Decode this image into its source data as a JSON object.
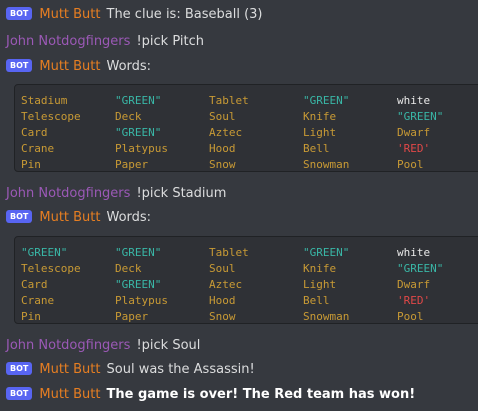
{
  "colors": {
    "background": "#36393f",
    "codeblock_bg": "#2f3136",
    "bot_badge": "#5865f2",
    "bot_author": "#e67e22",
    "user_author": "#9b59b6",
    "word_default": "#c89a35",
    "word_green": "#39b6a6",
    "word_red": "#e04848",
    "word_white": "#e8e8e8"
  },
  "badge_label": "BOT",
  "bot_name": "Mutt Butt",
  "user_name": "John Notdogfingers",
  "messages": {
    "m1": "The clue is: Baseball (3)",
    "m2": "!pick Pitch",
    "m3": "Words:",
    "m4": "!pick Stadium",
    "m5": "Words:",
    "m6": "!pick Soul",
    "m7": "Soul was the Assassin!",
    "m8": "The game is over! The Red team has won!"
  },
  "board1": [
    [
      {
        "text": "Stadium",
        "color": "default"
      },
      {
        "text": "\"GREEN\"",
        "color": "green"
      },
      {
        "text": "Tablet",
        "color": "default"
      },
      {
        "text": "\"GREEN\"",
        "color": "green"
      },
      {
        "text": "white",
        "color": "white"
      }
    ],
    [
      {
        "text": "Telescope",
        "color": "default"
      },
      {
        "text": "Deck",
        "color": "default"
      },
      {
        "text": "Soul",
        "color": "default"
      },
      {
        "text": "Knife",
        "color": "default"
      },
      {
        "text": "\"GREEN\"",
        "color": "green"
      }
    ],
    [
      {
        "text": "Card",
        "color": "default"
      },
      {
        "text": "\"GREEN\"",
        "color": "green"
      },
      {
        "text": "Aztec",
        "color": "default"
      },
      {
        "text": "Light",
        "color": "default"
      },
      {
        "text": "Dwarf",
        "color": "default"
      }
    ],
    [
      {
        "text": "Crane",
        "color": "default"
      },
      {
        "text": "Platypus",
        "color": "default"
      },
      {
        "text": "Hood",
        "color": "default"
      },
      {
        "text": "Bell",
        "color": "default"
      },
      {
        "text": "'RED'",
        "color": "red"
      }
    ],
    [
      {
        "text": "Pin",
        "color": "default"
      },
      {
        "text": "Paper",
        "color": "default"
      },
      {
        "text": "Snow",
        "color": "default"
      },
      {
        "text": "Snowman",
        "color": "default"
      },
      {
        "text": "Pool",
        "color": "default"
      }
    ]
  ],
  "board2": [
    [
      {
        "text": "\"GREEN\"",
        "color": "green"
      },
      {
        "text": "\"GREEN\"",
        "color": "green"
      },
      {
        "text": "Tablet",
        "color": "default"
      },
      {
        "text": "\"GREEN\"",
        "color": "green"
      },
      {
        "text": "white",
        "color": "white"
      }
    ],
    [
      {
        "text": "Telescope",
        "color": "default"
      },
      {
        "text": "Deck",
        "color": "default"
      },
      {
        "text": "Soul",
        "color": "default"
      },
      {
        "text": "Knife",
        "color": "default"
      },
      {
        "text": "\"GREEN\"",
        "color": "green"
      }
    ],
    [
      {
        "text": "Card",
        "color": "default"
      },
      {
        "text": "\"GREEN\"",
        "color": "green"
      },
      {
        "text": "Aztec",
        "color": "default"
      },
      {
        "text": "Light",
        "color": "default"
      },
      {
        "text": "Dwarf",
        "color": "default"
      }
    ],
    [
      {
        "text": "Crane",
        "color": "default"
      },
      {
        "text": "Platypus",
        "color": "default"
      },
      {
        "text": "Hood",
        "color": "default"
      },
      {
        "text": "Bell",
        "color": "default"
      },
      {
        "text": "'RED'",
        "color": "red"
      }
    ],
    [
      {
        "text": "Pin",
        "color": "default"
      },
      {
        "text": "Paper",
        "color": "default"
      },
      {
        "text": "Snow",
        "color": "default"
      },
      {
        "text": "Snowman",
        "color": "default"
      },
      {
        "text": "Pool",
        "color": "default"
      }
    ]
  ]
}
